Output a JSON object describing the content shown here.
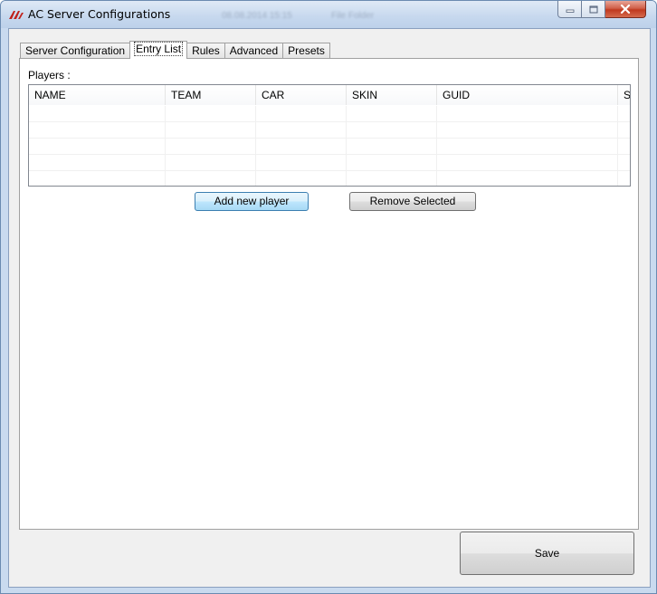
{
  "window": {
    "title": "AC Server Configurations",
    "blurred_title_fragments": [
      "08.08.2014 15:15",
      "File Folder"
    ],
    "controls": {
      "minimize_icon": "minimize-icon",
      "maximize_icon": "maximize-icon",
      "close_icon": "close-icon"
    },
    "colors": {
      "titlebar": "#c9daef",
      "close": "#c0391f",
      "focus_button": "#bee6fd"
    }
  },
  "tabs": [
    {
      "label": "Server Configuration",
      "active": false
    },
    {
      "label": "Entry List",
      "active": true
    },
    {
      "label": "Rules",
      "active": false
    },
    {
      "label": "Advanced",
      "active": false
    },
    {
      "label": "Presets",
      "active": false
    }
  ],
  "entry_list": {
    "players_label": "Players :",
    "columns": [
      "NAME",
      "TEAM",
      "CAR",
      "SKIN",
      "GUID",
      "S"
    ],
    "rows": [],
    "add_button": "Add new player",
    "remove_button": "Remove Selected"
  },
  "footer": {
    "save_button": "Save"
  }
}
